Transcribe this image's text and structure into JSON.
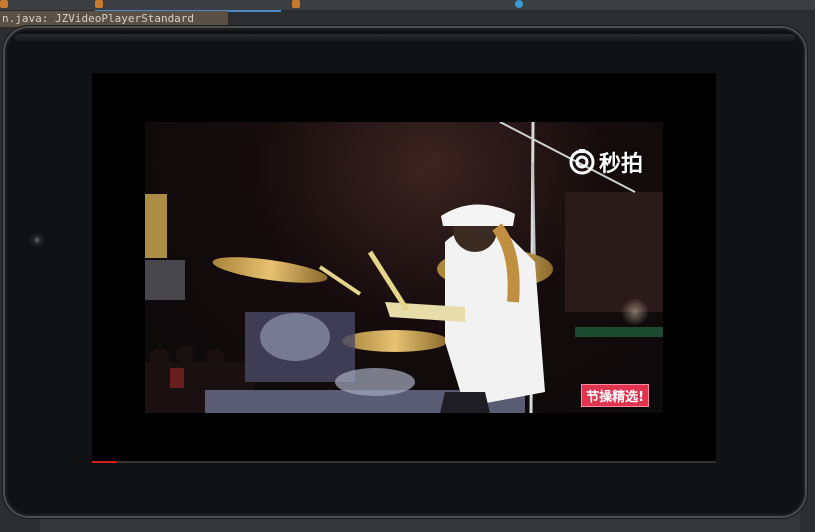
{
  "ide": {
    "tabs": [
      {
        "label": "",
        "color": "#c97a2c",
        "active": false
      },
      {
        "label": "",
        "color": "#c97a2c",
        "active": true
      },
      {
        "label": "",
        "color": "#c97a2c",
        "active": false
      },
      {
        "label": "",
        "color": "#3b9bd6",
        "active": false
      }
    ],
    "popup_text": "n.java: JZVideoPlayerStandard"
  },
  "video": {
    "watermark_text": "秒拍",
    "watermark_icon": "camera-shutter-icon",
    "badge_text": "节操精选!",
    "progress_fraction": 0.04
  },
  "colors": {
    "frame": "#111213",
    "screen": "#000000",
    "progress": "#d02020",
    "badge": "#e0334f"
  }
}
